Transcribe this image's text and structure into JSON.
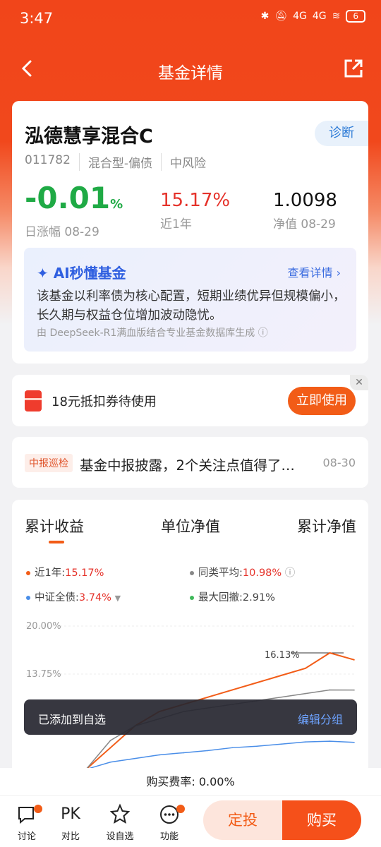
{
  "status": {
    "time": "3:47",
    "battery": "6",
    "net1": "4G",
    "net2": "4G"
  },
  "nav": {
    "title": "基金详情"
  },
  "fund": {
    "name": "泓德慧享混合C",
    "diagnose": "诊断",
    "code": "011782",
    "type": "混合型-偏债",
    "risk": "中风险",
    "daily_value": "-0.01",
    "daily_unit": "%",
    "daily_label": "日涨幅 08-29",
    "year_value": "15.17%",
    "year_label": "近1年",
    "nav_value": "1.0098",
    "nav_label": "净值 08-29"
  },
  "ai": {
    "title": "AI秒懂基金",
    "more": "查看详情 ›",
    "body": "该基金以利率债为核心配置，短期业绩优异但规模偏小，长久期与权益仓位增加波动隐忧。",
    "source": "由 DeepSeek-R1满血版结合专业基金数据库生成 ⓘ"
  },
  "coupon": {
    "text": "18元抵扣券待使用",
    "button": "立即使用",
    "close": "✕"
  },
  "news": {
    "tag": "中报巡检",
    "text": "基金中报披露，2个关注点值得了…",
    "date": "08-30"
  },
  "chart_tabs": [
    "累计收益",
    "单位净值",
    "累计净值"
  ],
  "legend": {
    "l1_label": "近1年:",
    "l1_value": "15.17%",
    "l2_label": "同类平均:",
    "l2_value": "10.98%",
    "l3_label": "中证全债:",
    "l3_value": "3.74%",
    "l4_label": "最大回撤:",
    "l4_value": "2.91%"
  },
  "chart_data": {
    "type": "line",
    "yticks": [
      "20.00%",
      "13.75%"
    ],
    "annotation": "16.13%",
    "series": [
      {
        "name": "近1年",
        "color": "#f25c17",
        "values": [
          0,
          3,
          6,
          8,
          9,
          10,
          11,
          12,
          13,
          14,
          16.13,
          15.17
        ]
      },
      {
        "name": "同类平均",
        "color": "#888888",
        "values": [
          0,
          4,
          6,
          7,
          8,
          8.5,
          9,
          9.5,
          10,
          10.5,
          11,
          10.98
        ]
      },
      {
        "name": "中证全债",
        "color": "#4a8ee8",
        "values": [
          0,
          1,
          1.5,
          2,
          2.3,
          2.6,
          3,
          3.2,
          3.5,
          3.8,
          3.9,
          3.74
        ]
      }
    ]
  },
  "toast": {
    "text": "已添加到自选",
    "action": "编辑分组"
  },
  "fee": "购买费率: 0.00%",
  "bottom": {
    "discuss": "讨论",
    "pk_icon": "PK",
    "compare": "对比",
    "watch": "设自选",
    "func": "功能",
    "dingtou": "定投",
    "buy": "购买"
  },
  "colors": {
    "brand": "#f25c17",
    "up": "#e5322a",
    "down": "#1faa45"
  }
}
